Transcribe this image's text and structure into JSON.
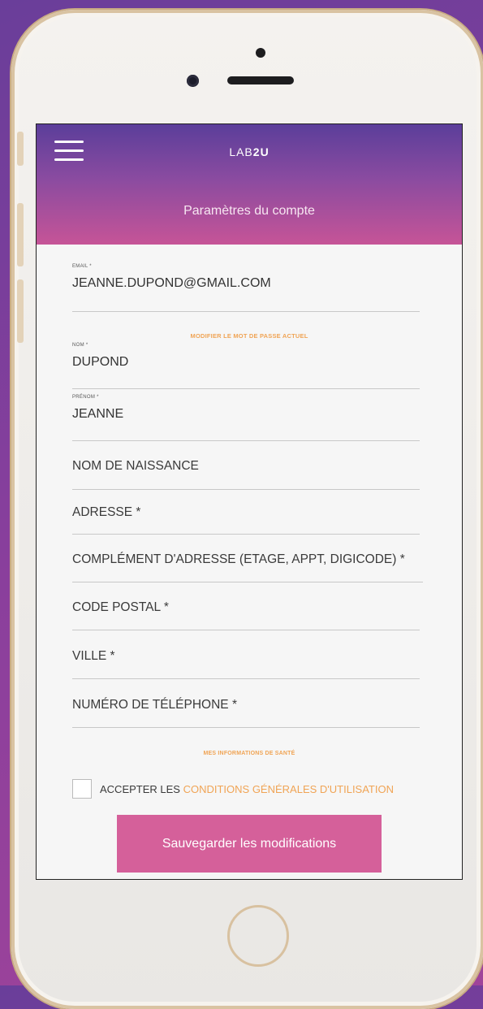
{
  "app": {
    "brand_prefix": "LAB",
    "brand_bold": "2U",
    "page_title": "Paramètres du compte"
  },
  "fields": {
    "email": {
      "label": "EMAIL *",
      "value": "JEANNE.DUPOND@GMAIL.COM"
    },
    "change_password_link": "MODIFIER LE MOT DE PASSE ACTUEL",
    "nom": {
      "label": "NOM *",
      "value": "DUPOND"
    },
    "prenom": {
      "label": "PRÉNOM *",
      "value": "JEANNE"
    },
    "nom_naissance": {
      "placeholder": "NOM DE NAISSANCE"
    },
    "adresse": {
      "placeholder": "ADRESSE *"
    },
    "complement": {
      "placeholder": "COMPLÉMENT D'ADRESSE (ETAGE, APPT, DIGICODE) *"
    },
    "code_postal": {
      "placeholder": "CODE POSTAL *"
    },
    "ville": {
      "placeholder": "VILLE *"
    },
    "telephone": {
      "placeholder": "NUMÉRO DE TÉLÉPHONE *"
    }
  },
  "health_link": "MES INFORMATIONS DE SANTÉ",
  "cgu": {
    "prefix": "ACCEPTER LES ",
    "link": "CONDITIONS GÉNÉRALES D'UTILISATION",
    "checked": false
  },
  "save_button": "Sauvegarder les modifications",
  "colors": {
    "header_top": "#5b3e9a",
    "header_bottom": "#c65497",
    "accent_orange": "#f0a455",
    "button_pink": "#d5609a"
  }
}
